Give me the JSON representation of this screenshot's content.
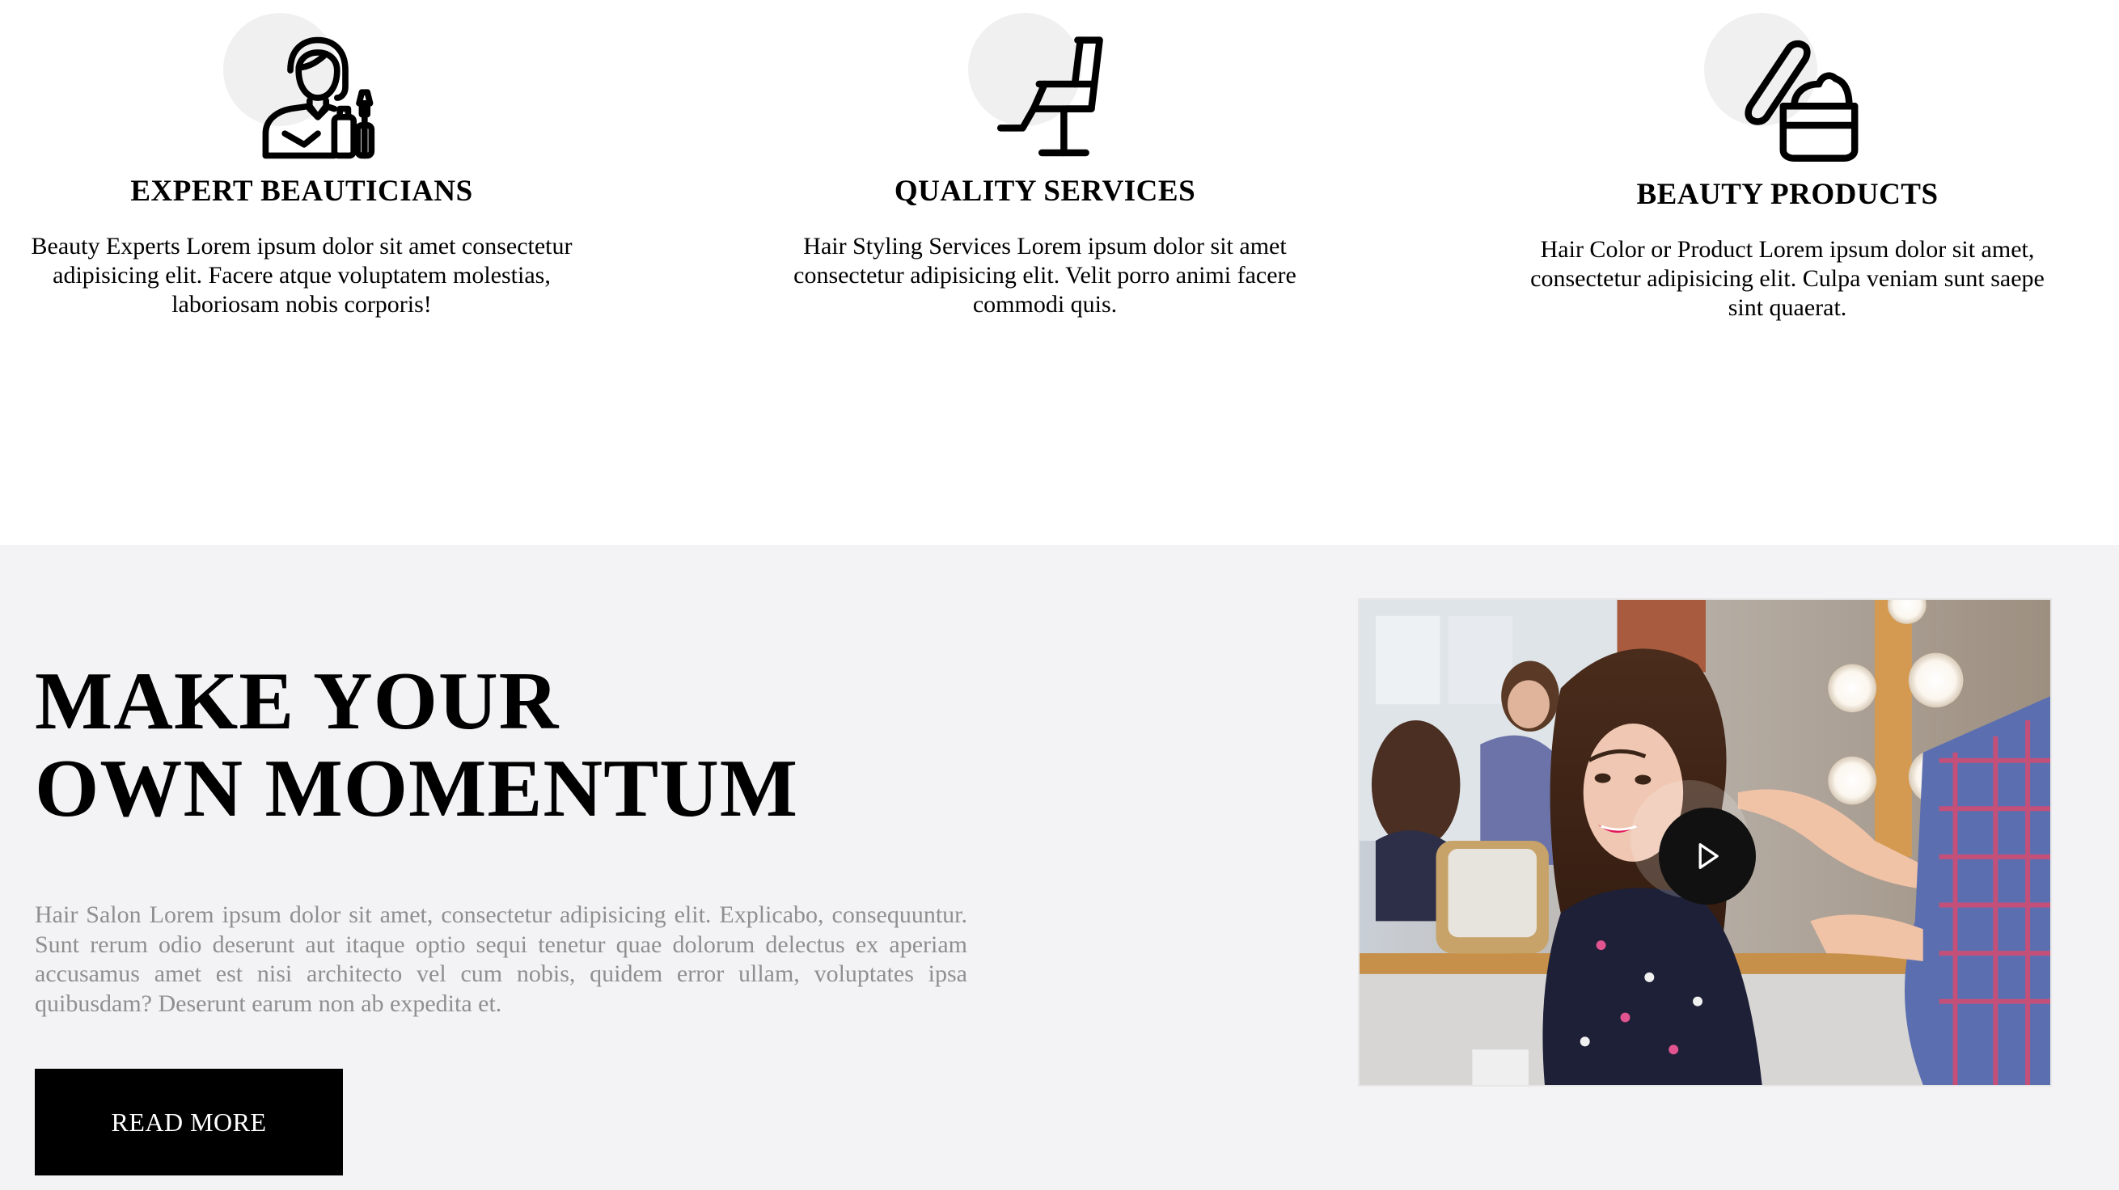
{
  "features": [
    {
      "icon": "beautician-icon",
      "title": "EXPERT BEAUTICIANS",
      "text": "Beauty Experts Lorem ipsum dolor sit amet consectetur adipisicing elit. Facere atque voluptatem molestias, laboriosam nobis corporis!"
    },
    {
      "icon": "salon-chair-icon",
      "title": "QUALITY SERVICES",
      "text": "Hair Styling Services Lorem ipsum dolor sit amet consectetur adipisicing elit. Velit porro animi facere commodi quis."
    },
    {
      "icon": "cream-jar-icon",
      "title": "BEAUTY PRODUCTS",
      "text": "Hair Color or Product Lorem ipsum dolor sit amet, consectetur adipisicing elit. Culpa veniam sunt saepe sint quaerat."
    }
  ],
  "momentum": {
    "heading_line1": "MAKE YOUR",
    "heading_line2": "OWN MOMENTUM",
    "text": "Hair Salon Lorem ipsum dolor sit amet, consectetur adipisicing elit. Explicabo, consequuntur. Sunt rerum odio deserunt aut itaque optio sequi tenetur quae dolorum delectus ex aperiam accusamus amet est nisi architecto vel cum nobis, quidem error ullam, voluptates ipsa quibusdam? Deserunt earum non ab expedita et.",
    "button_label": "READ MORE",
    "video": {
      "icon": "play-icon"
    }
  },
  "colors": {
    "page_bg": "#ffffff",
    "section_bg": "#f3f3f5",
    "icon_circle": "#f0f0f1",
    "body_text_muted": "#8f8f8f",
    "button_bg": "#000000",
    "button_text": "#ffffff"
  }
}
